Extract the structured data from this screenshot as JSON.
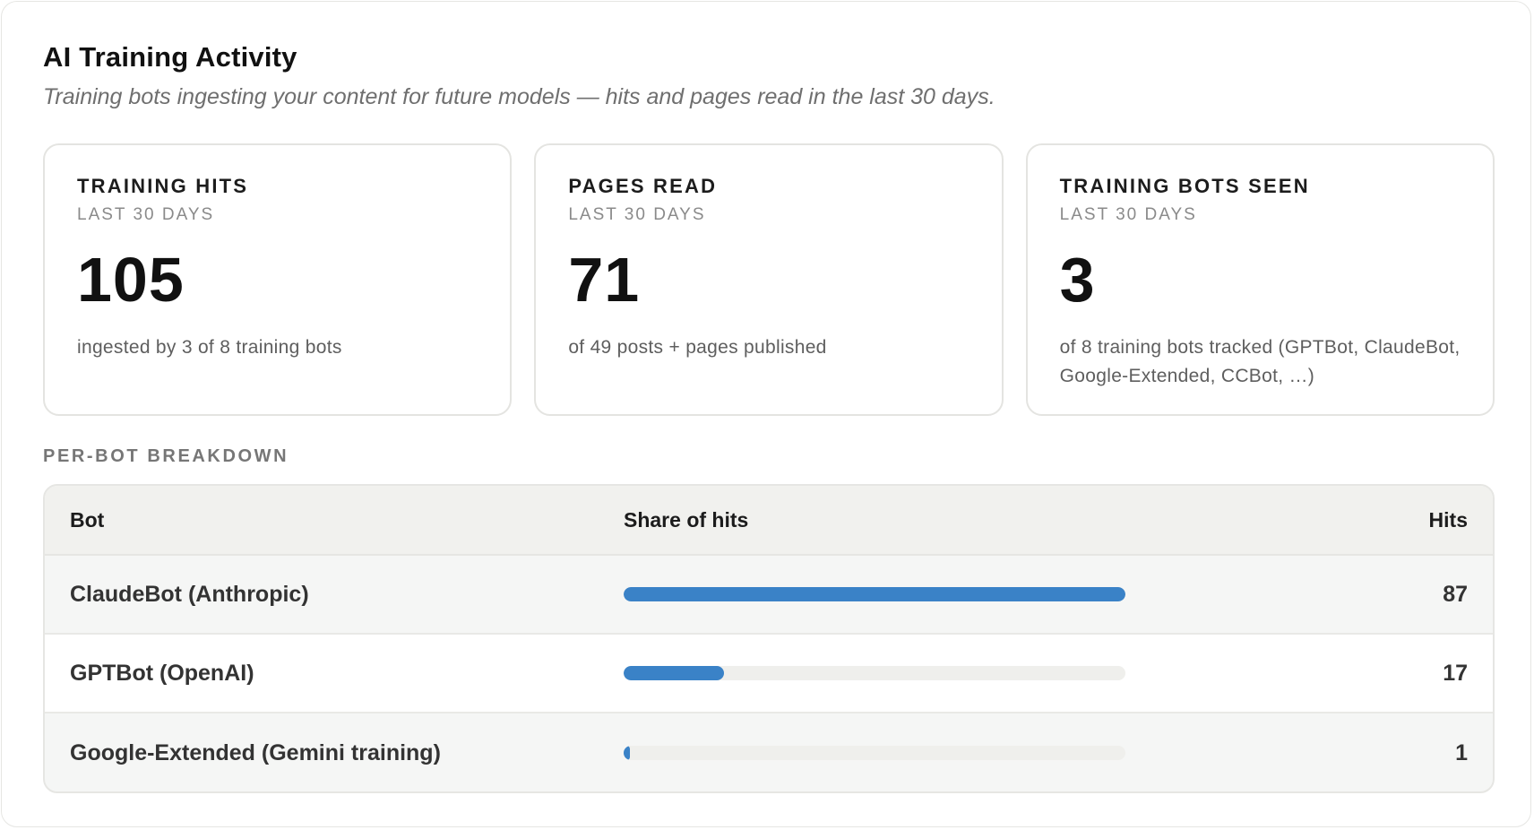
{
  "header": {
    "title": "AI Training Activity",
    "subtitle": "Training bots ingesting your content for future models — hits and pages read in the last 30 days."
  },
  "cards": [
    {
      "label": "TRAINING HITS",
      "period": "LAST 30 DAYS",
      "value": "105",
      "description": "ingested by 3 of 8 training bots"
    },
    {
      "label": "PAGES READ",
      "period": "LAST 30 DAYS",
      "value": "71",
      "description": "of 49 posts + pages published"
    },
    {
      "label": "TRAINING BOTS SEEN",
      "period": "LAST 30 DAYS",
      "value": "3",
      "description": "of 8 training bots tracked (GPTBot, ClaudeBot, Google-Extended, CCBot, …)"
    }
  ],
  "breakdown": {
    "section_label": "PER-BOT BREAKDOWN",
    "columns": {
      "bot": "Bot",
      "share": "Share of hits",
      "hits": "Hits"
    },
    "rows": [
      {
        "bot": "ClaudeBot (Anthropic)",
        "hits": "87",
        "share": 1.0
      },
      {
        "bot": "GPTBot (OpenAI)",
        "hits": "17",
        "share": 0.2
      },
      {
        "bot": "Google-Extended (Gemini training)",
        "hits": "1",
        "share": 0.012
      }
    ]
  },
  "colors": {
    "bar_fill": "#3a82c7",
    "bar_track": "#efefec"
  }
}
